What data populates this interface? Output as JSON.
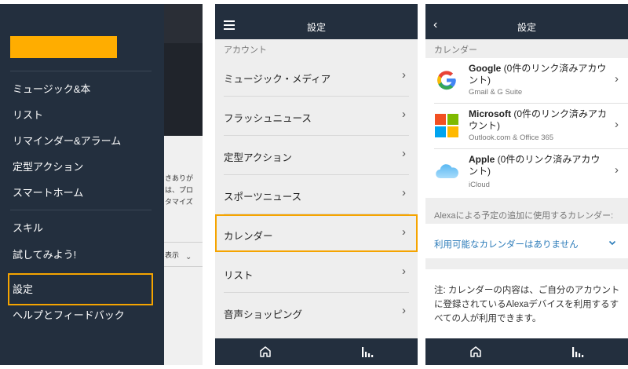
{
  "drawer": {
    "items": [
      {
        "label": "ミュージック&本"
      },
      {
        "label": "リスト"
      },
      {
        "label": "リマインダー&アラーム"
      },
      {
        "label": "定型アクション"
      },
      {
        "label": "スマートホーム"
      },
      {
        "label": "スキル"
      },
      {
        "label": "試してみよう!"
      },
      {
        "label": "設定"
      },
      {
        "label": "ヘルプとフィードバック"
      }
    ],
    "behind_fragments": [
      "きありが",
      "は、プロ",
      "タマイズ",
      "表示"
    ]
  },
  "settings": {
    "title": "設定",
    "section": "アカウント",
    "rows": [
      {
        "label": "ミュージック・メディア"
      },
      {
        "label": "フラッシュニュース"
      },
      {
        "label": "定型アクション"
      },
      {
        "label": "スポーツニュース"
      },
      {
        "label": "カレンダー"
      },
      {
        "label": "リスト"
      },
      {
        "label": "音声ショッピング"
      }
    ]
  },
  "calendar": {
    "title": "設定",
    "section": "カレンダー",
    "accounts": [
      {
        "name": "Google",
        "status": " (0件のリンク済みアカウント)",
        "sub": "Gmail & G Suite",
        "icon": "google-icon"
      },
      {
        "name": "Microsoft",
        "status": " (0件のリンク済みアカウント)",
        "sub": "Outlook.com & Office 365",
        "icon": "microsoft-icon"
      },
      {
        "name": "Apple",
        "status": " (0件のリンク済みアカウント)",
        "sub": "iCloud",
        "icon": "icloud-icon"
      }
    ],
    "default_label": "Alexaによる予定の追加に使用するカレンダー:",
    "dropdown_value": "利用可能なカレンダーはありません",
    "note": "注: カレンダーの内容は、ご自分のアカウントに登録されているAlexaデバイスを利用するすべての人が利用できます。"
  },
  "colors": {
    "header": "#232f3e",
    "accent": "#f5a400",
    "logo": "#ffad00",
    "link": "#2b7bb9"
  }
}
